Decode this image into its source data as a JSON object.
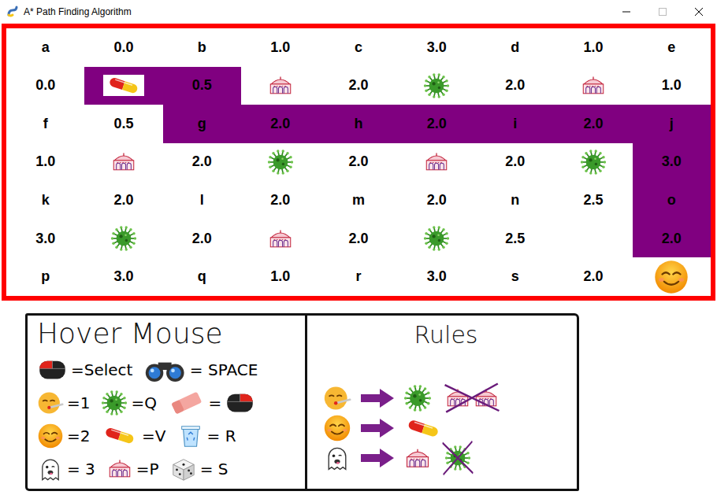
{
  "window": {
    "title": "A* Path Finding Algorithm"
  },
  "grid": {
    "rows": [
      [
        {
          "kind": "text",
          "text": "a",
          "path": false
        },
        {
          "kind": "text",
          "text": "0.0",
          "path": false
        },
        {
          "kind": "text",
          "text": "b",
          "path": false
        },
        {
          "kind": "text",
          "text": "1.0",
          "path": false
        },
        {
          "kind": "text",
          "text": "c",
          "path": false
        },
        {
          "kind": "text",
          "text": "3.0",
          "path": false
        },
        {
          "kind": "text",
          "text": "d",
          "path": false
        },
        {
          "kind": "text",
          "text": "1.0",
          "path": false
        },
        {
          "kind": "text",
          "text": "e",
          "path": false
        }
      ],
      [
        {
          "kind": "text",
          "text": "0.0",
          "path": false
        },
        {
          "kind": "pill",
          "text": "",
          "path": true
        },
        {
          "kind": "text",
          "text": "0.5",
          "path": true
        },
        {
          "kind": "palace",
          "text": "",
          "path": false
        },
        {
          "kind": "text",
          "text": "2.0",
          "path": false
        },
        {
          "kind": "virus",
          "text": "",
          "path": false
        },
        {
          "kind": "text",
          "text": "2.0",
          "path": false
        },
        {
          "kind": "palace",
          "text": "",
          "path": false
        },
        {
          "kind": "text",
          "text": "1.0",
          "path": false
        }
      ],
      [
        {
          "kind": "text",
          "text": "f",
          "path": false
        },
        {
          "kind": "text",
          "text": "0.5",
          "path": false
        },
        {
          "kind": "text",
          "text": "g",
          "path": true
        },
        {
          "kind": "text",
          "text": "2.0",
          "path": true
        },
        {
          "kind": "text",
          "text": "h",
          "path": true
        },
        {
          "kind": "text",
          "text": "2.0",
          "path": true
        },
        {
          "kind": "text",
          "text": "i",
          "path": true
        },
        {
          "kind": "text",
          "text": "2.0",
          "path": true
        },
        {
          "kind": "text",
          "text": "j",
          "path": true
        }
      ],
      [
        {
          "kind": "text",
          "text": "1.0",
          "path": false
        },
        {
          "kind": "palace",
          "text": "",
          "path": false
        },
        {
          "kind": "text",
          "text": "2.0",
          "path": false
        },
        {
          "kind": "virus",
          "text": "",
          "path": false
        },
        {
          "kind": "text",
          "text": "2.0",
          "path": false
        },
        {
          "kind": "palace",
          "text": "",
          "path": false
        },
        {
          "kind": "text",
          "text": "2.0",
          "path": false
        },
        {
          "kind": "virus",
          "text": "",
          "path": false
        },
        {
          "kind": "text",
          "text": "3.0",
          "path": true
        }
      ],
      [
        {
          "kind": "text",
          "text": "k",
          "path": false
        },
        {
          "kind": "text",
          "text": "2.0",
          "path": false
        },
        {
          "kind": "text",
          "text": "l",
          "path": false
        },
        {
          "kind": "text",
          "text": "2.0",
          "path": false
        },
        {
          "kind": "text",
          "text": "m",
          "path": false
        },
        {
          "kind": "text",
          "text": "2.0",
          "path": false
        },
        {
          "kind": "text",
          "text": "n",
          "path": false
        },
        {
          "kind": "text",
          "text": "2.5",
          "path": false
        },
        {
          "kind": "text",
          "text": "o",
          "path": true
        }
      ],
      [
        {
          "kind": "text",
          "text": "3.0",
          "path": false
        },
        {
          "kind": "virus",
          "text": "",
          "path": false
        },
        {
          "kind": "text",
          "text": "2.0",
          "path": false
        },
        {
          "kind": "palace",
          "text": "",
          "path": false
        },
        {
          "kind": "text",
          "text": "2.0",
          "path": false
        },
        {
          "kind": "virus",
          "text": "",
          "path": false
        },
        {
          "kind": "text",
          "text": "2.5",
          "path": false
        },
        {
          "kind": "empty",
          "text": "",
          "path": false
        },
        {
          "kind": "text",
          "text": "2.0",
          "path": true
        }
      ],
      [
        {
          "kind": "text",
          "text": "p",
          "path": false
        },
        {
          "kind": "text",
          "text": "3.0",
          "path": false
        },
        {
          "kind": "text",
          "text": "q",
          "path": false
        },
        {
          "kind": "text",
          "text": "1.0",
          "path": false
        },
        {
          "kind": "text",
          "text": "r",
          "path": false
        },
        {
          "kind": "text",
          "text": "3.0",
          "path": false
        },
        {
          "kind": "text",
          "text": "s",
          "path": false
        },
        {
          "kind": "text",
          "text": "2.0",
          "path": false
        },
        {
          "kind": "smiley",
          "text": "",
          "path": false
        }
      ]
    ]
  },
  "legend": {
    "title": "Hover Mouse",
    "rows": [
      [
        {
          "kind": "mouse",
          "label": "=Select",
          "after": ""
        },
        {
          "kind": "binoculars",
          "label": "= SPACE",
          "after": ""
        }
      ],
      [
        {
          "kind": "sick",
          "label": "=1",
          "after": ""
        },
        {
          "kind": "virus",
          "label": "=Q",
          "after": ""
        },
        {
          "kind": "eraser",
          "label": "=",
          "after": "mouse-right"
        }
      ],
      [
        {
          "kind": "smiley",
          "label": "=2",
          "after": ""
        },
        {
          "kind": "pill",
          "label": "=V",
          "after": ""
        },
        {
          "kind": "bin",
          "label": "= R",
          "after": ""
        }
      ],
      [
        {
          "kind": "ghost",
          "label": "= 3",
          "after": ""
        },
        {
          "kind": "palace",
          "label": "=P",
          "after": ""
        },
        {
          "kind": "dice",
          "label": "= S",
          "after": ""
        }
      ]
    ]
  },
  "rules": {
    "title": "Rules",
    "rows": [
      {
        "kind": "sick",
        "target": "virus",
        "banned": [
          "palace",
          "palace"
        ]
      },
      {
        "kind": "smiley",
        "target": "pill",
        "banned": []
      },
      {
        "kind": "ghost",
        "target": "palace",
        "banned": [
          "virus"
        ]
      }
    ]
  }
}
